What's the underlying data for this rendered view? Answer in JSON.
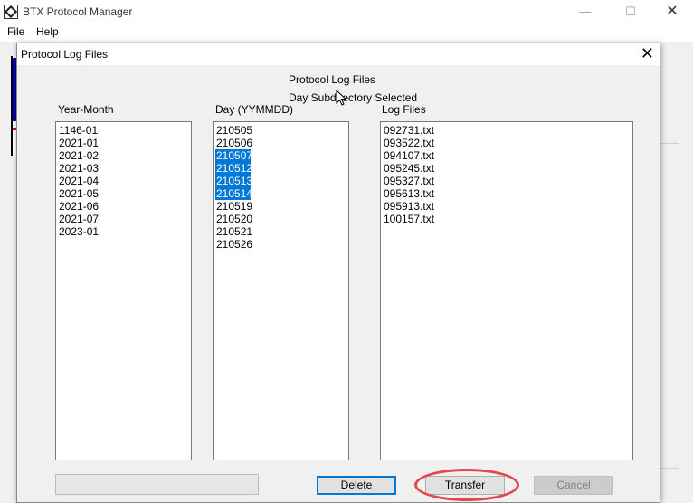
{
  "main_window": {
    "title": "BTX Protocol Manager",
    "window_buttons": {
      "minimize": "—",
      "maximize": "☐",
      "close": "✕"
    },
    "menu": [
      "File",
      "Help"
    ]
  },
  "dialog": {
    "title": "Protocol Log Files",
    "close_glyph": "✕",
    "header_line1": "Protocol Log Files",
    "header_line2": "Day Subdirectory Selected",
    "columns": {
      "year_month": {
        "label": "Year-Month",
        "items": [
          "1146-01",
          "2021-01",
          "2021-02",
          "2021-03",
          "2021-04",
          "2021-05",
          "2021-06",
          "2021-07",
          "2023-01"
        ]
      },
      "day": {
        "label": "Day (YYMMDD)",
        "items": [
          "210505",
          "210506",
          "210507",
          "210512",
          "210513",
          "210514",
          "210519",
          "210520",
          "210521",
          "210526"
        ],
        "selected": [
          "210507",
          "210512",
          "210513",
          "210514"
        ]
      },
      "log_files": {
        "label": "Log Files",
        "items": [
          "092731.txt",
          "093522.txt",
          "094107.txt",
          "095245.txt",
          "095327.txt",
          "095613.txt",
          "095913.txt",
          "100157.txt"
        ]
      }
    },
    "buttons": {
      "delete": "Delete",
      "transfer": "Transfer",
      "cancel": "Cancel"
    },
    "progress": 0,
    "highlight_color": "#e0494d",
    "selection_color": "#0078d7"
  }
}
